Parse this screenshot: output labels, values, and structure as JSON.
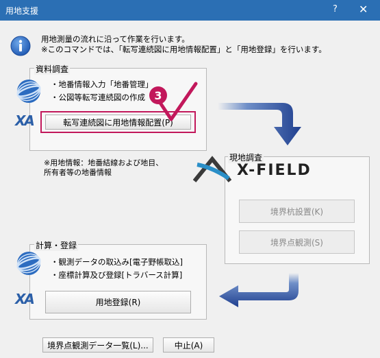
{
  "window": {
    "title": "用地支援",
    "help_glyph": "?",
    "close_glyph": "✕"
  },
  "intro": {
    "icon": "info-icon",
    "line1": "用地測量の流れに沿って作業を行います。",
    "line2": "※このコマンドでは、「転写連続図に用地情報配置」と「用地登録」を行います。"
  },
  "shiryou": {
    "title": "資料調査",
    "bullet1": "・地番情報入力「地番管理」",
    "bullet2": "・公図等転写連続図の作成",
    "button_label": "転写連続図に用地情報配置(P)",
    "step_number": "3",
    "logo_text": "XA"
  },
  "note": {
    "line1": "※用地情報：地番結線および地目、",
    "line2": "所有者等の地番情報"
  },
  "genchi": {
    "title": "現地調査",
    "logo_text": "X-FIELD",
    "button1_label": "境界杭設置(K)",
    "button2_label": "境界点観測(S)"
  },
  "keisan": {
    "title": "計算・登録",
    "bullet1": "・観測データの取込み[電子野帳取込]",
    "bullet2": "・座標計算及び登録[トラバース計算]",
    "button_label": "用地登録(R)",
    "logo_text": "XA"
  },
  "footer": {
    "list_button_label": "境界点観測データ一覧(L)...",
    "cancel_button_label": "中止(A)"
  },
  "colors": {
    "titlebar": "#2b6fb4",
    "highlight": "#c2185b",
    "arrow": "#1f3f8f"
  }
}
